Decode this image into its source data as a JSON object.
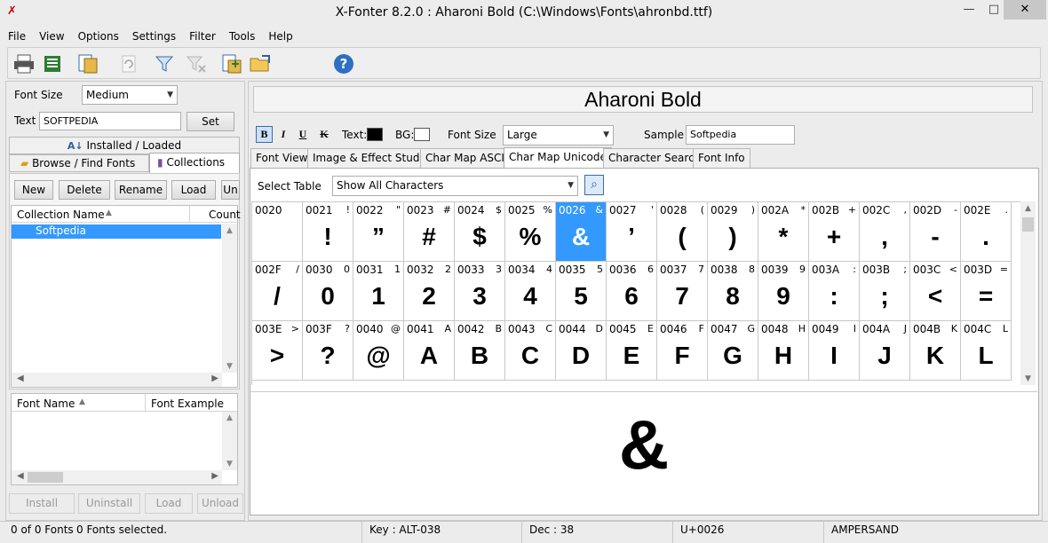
{
  "window": {
    "title": "X-Fonter 8.2.0  :  Aharoni Bold (C:\\Windows\\Fonts\\ahronbd.ttf)"
  },
  "menu": [
    "File",
    "View",
    "Options",
    "Settings",
    "Filter",
    "Tools",
    "Help"
  ],
  "left": {
    "font_size_label": "Font Size",
    "font_size_value": "Medium",
    "text_label": "Text",
    "text_value": "SOFTPEDIA",
    "set_label": "Set",
    "tab_installed": "Installed / Loaded",
    "tab_browse": "Browse / Find Fonts",
    "tab_collections": "Collections",
    "buttons": [
      "New",
      "Delete",
      "Rename",
      "Load",
      "Un"
    ],
    "col_collection": "Collection Name",
    "col_count": "Count",
    "collection_item": "Softpedia",
    "col_font_name": "Font Name",
    "col_font_example": "Font Example",
    "bottom_buttons": [
      "Install",
      "Uninstall",
      "Load",
      "Unload"
    ]
  },
  "right": {
    "font_title": "Aharoni Bold",
    "fmt": {
      "bold": "B",
      "italic": "I",
      "underline": "U",
      "strike": "K",
      "text_label": "Text:",
      "bg_label": "BG:",
      "font_size_label": "Font Size",
      "font_size_value": "Large",
      "sample_label": "Sample",
      "sample_value": "Softpedia"
    },
    "tabs": [
      "Font View",
      "Image & Effect Studio",
      "Char Map ASCII",
      "Char Map Unicode",
      "Character Search",
      "Font Info"
    ],
    "select_table_label": "Select Table",
    "select_table_value": "Show All Characters",
    "preview_char": "&"
  },
  "grid": [
    [
      [
        "0020",
        " ",
        " "
      ],
      [
        "0021",
        "!",
        "!"
      ],
      [
        "0022",
        "\"",
        "”"
      ],
      [
        "0023",
        "#",
        "#"
      ],
      [
        "0024",
        "$",
        "$"
      ],
      [
        "0025",
        "%",
        "%"
      ],
      [
        "0026",
        "&",
        "&"
      ],
      [
        "0027",
        "'",
        "’"
      ],
      [
        "0028",
        "(",
        "("
      ],
      [
        "0029",
        ")",
        ")"
      ],
      [
        "002A",
        "*",
        "*"
      ],
      [
        "002B",
        "+",
        "+"
      ],
      [
        "002C",
        ",",
        ","
      ],
      [
        "002D",
        "-",
        "-"
      ],
      [
        "002E",
        ".",
        "."
      ]
    ],
    [
      [
        "002F",
        "/",
        "/"
      ],
      [
        "0030",
        "0",
        "0"
      ],
      [
        "0031",
        "1",
        "1"
      ],
      [
        "0032",
        "2",
        "2"
      ],
      [
        "0033",
        "3",
        "3"
      ],
      [
        "0034",
        "4",
        "4"
      ],
      [
        "0035",
        "5",
        "5"
      ],
      [
        "0036",
        "6",
        "6"
      ],
      [
        "0037",
        "7",
        "7"
      ],
      [
        "0038",
        "8",
        "8"
      ],
      [
        "0039",
        "9",
        "9"
      ],
      [
        "003A",
        ":",
        ":"
      ],
      [
        "003B",
        ";",
        ";"
      ],
      [
        "003C",
        "<",
        "<"
      ],
      [
        "003D",
        "=",
        "="
      ]
    ],
    [
      [
        "003E",
        ">",
        ">"
      ],
      [
        "003F",
        "?",
        "?"
      ],
      [
        "0040",
        "@",
        "@"
      ],
      [
        "0041",
        "A",
        "A"
      ],
      [
        "0042",
        "B",
        "B"
      ],
      [
        "0043",
        "C",
        "C"
      ],
      [
        "0044",
        "D",
        "D"
      ],
      [
        "0045",
        "E",
        "E"
      ],
      [
        "0046",
        "F",
        "F"
      ],
      [
        "0047",
        "G",
        "G"
      ],
      [
        "0048",
        "H",
        "H"
      ],
      [
        "0049",
        "I",
        "I"
      ],
      [
        "004A",
        "J",
        "J"
      ],
      [
        "004B",
        "K",
        "K"
      ],
      [
        "004C",
        "L",
        "L"
      ]
    ]
  ],
  "status": {
    "fonts": "0 of 0 Fonts",
    "selected": "0 Fonts selected.",
    "key": "Key : ALT-038",
    "dec": "Dec : 38",
    "unicode": "U+0026",
    "name": "AMPERSAND"
  },
  "colors": {
    "selection": "#3399ff",
    "accent_title_x": "#cc0000"
  }
}
